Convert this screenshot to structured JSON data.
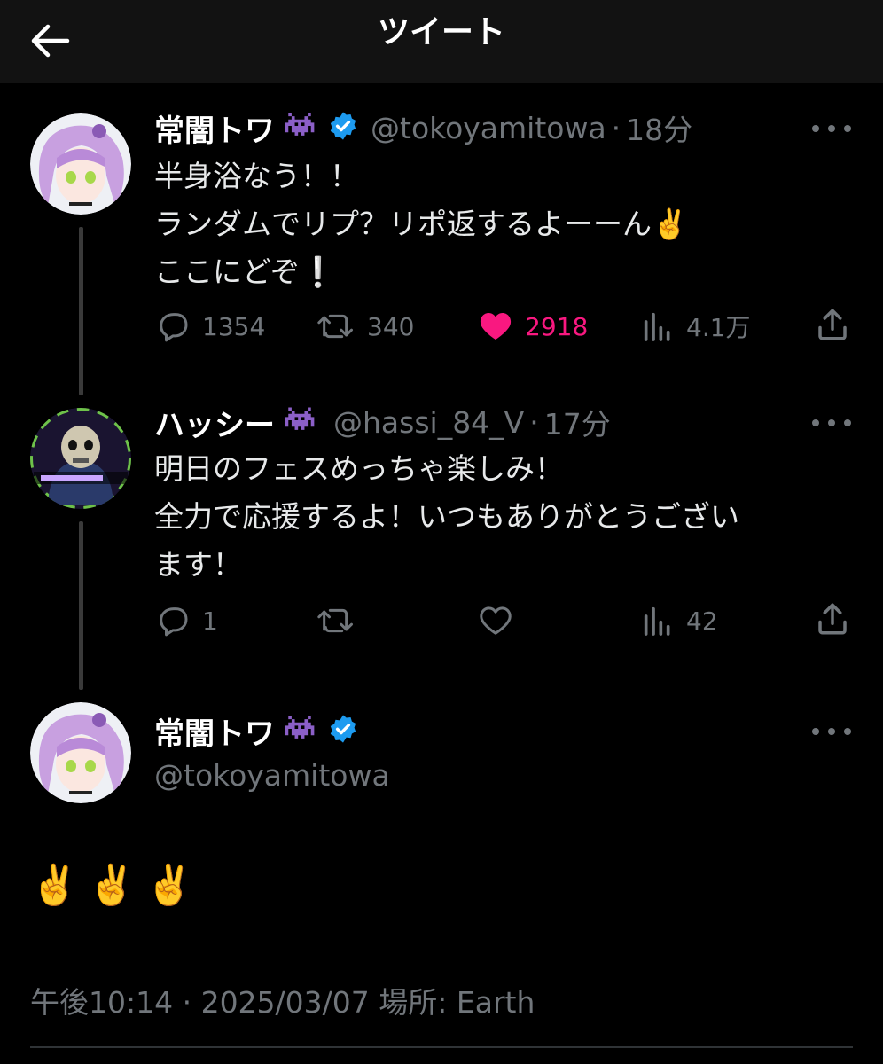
{
  "header": {
    "title": "ツイート"
  },
  "tweets": [
    {
      "name": "常闇トワ",
      "handle": "@tokoyamitowa",
      "time": "18分",
      "lines": [
        "半身浴なう！！",
        "ランダムでリプ？リポ返するよーーん✌️",
        "ここにどぞ❕"
      ],
      "reply_count": "1354",
      "repost_count": "340",
      "like_count": "2918",
      "view_count": "4.1万"
    },
    {
      "name": "ハッシー",
      "handle": "@hassi_84_V",
      "time": "17分",
      "lines": [
        "明日のフェスめっちゃ楽しみ！",
        "全力で応援するよ！いつもありがとうござい",
        "ます！"
      ],
      "reply_count": "1",
      "view_count": "42"
    }
  ],
  "main_tweet": {
    "name": "常闇トワ",
    "handle": "@tokoyamitowa",
    "text": "✌️✌️✌️",
    "timestamp": "午後10:14 · 2025/03/07 場所: Earth"
  },
  "colors": {
    "like": "#f91880",
    "verified": "#1d9bf0",
    "muted": "#71767b"
  }
}
